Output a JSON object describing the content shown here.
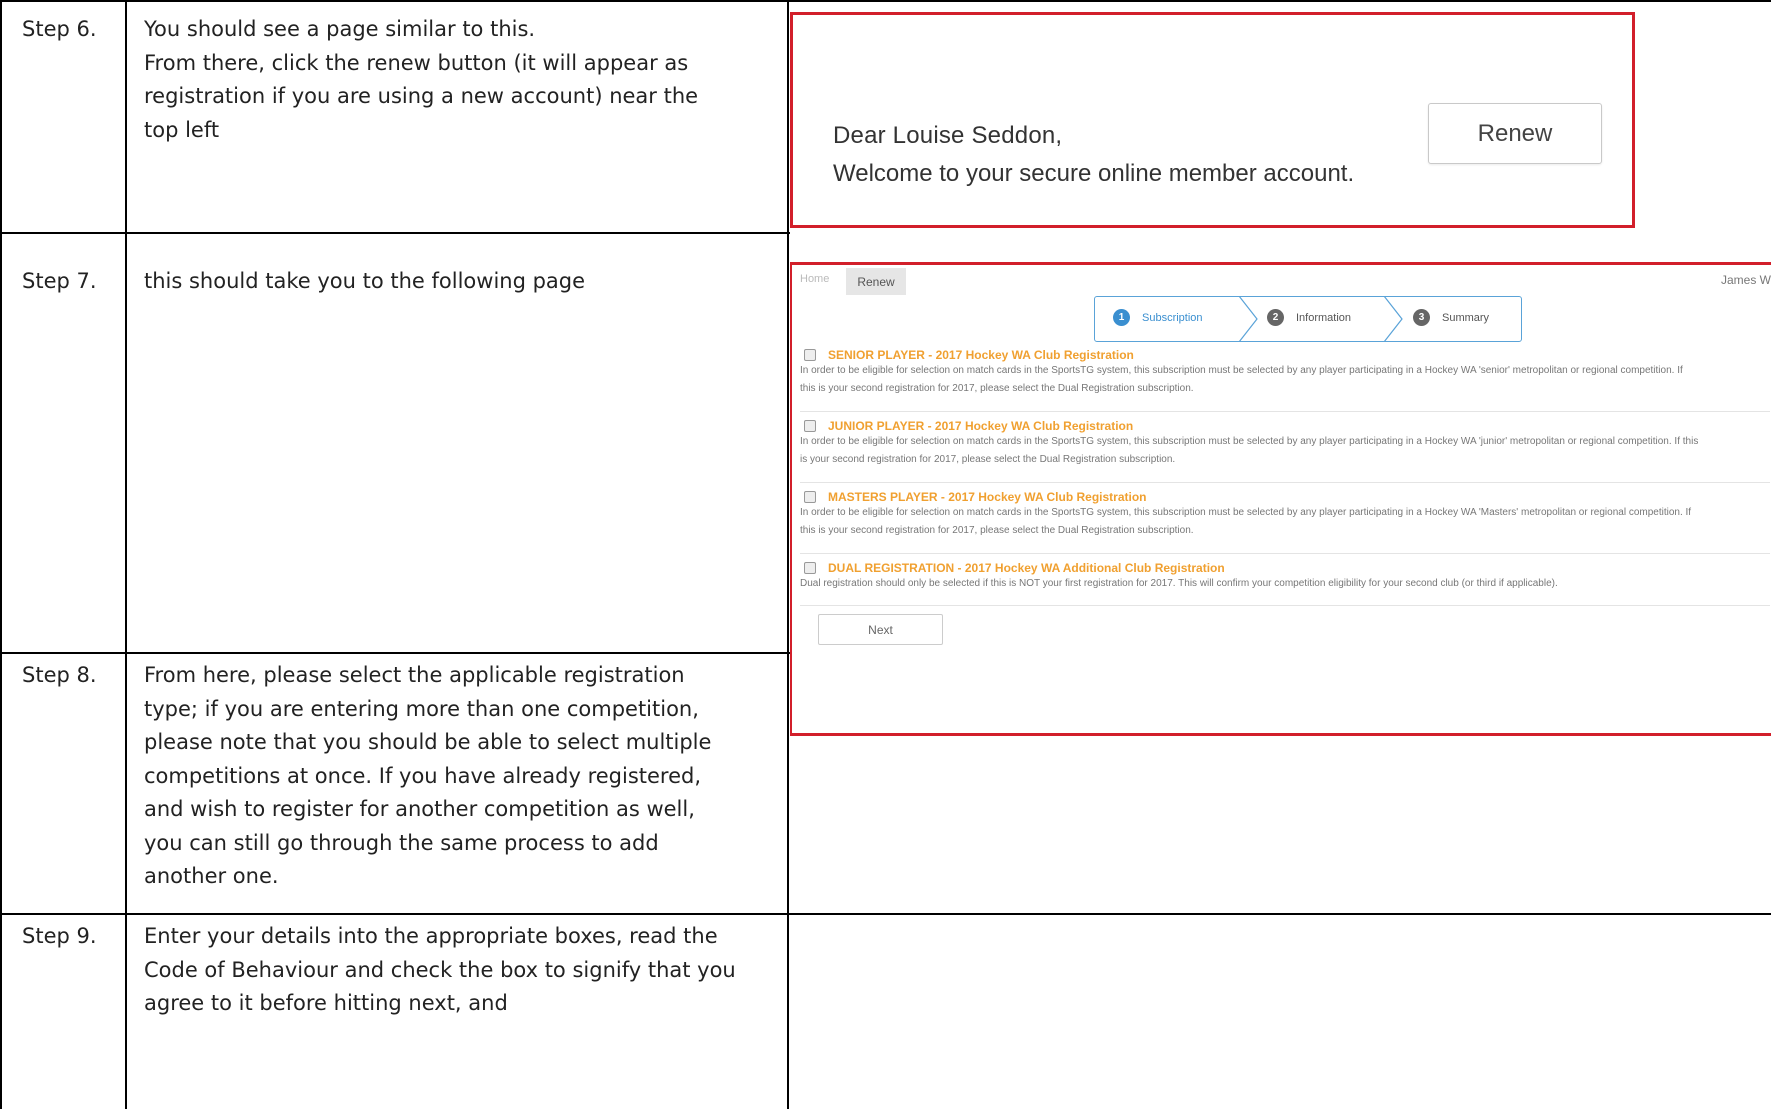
{
  "rows": [
    {
      "step": "Step 6.",
      "lines": [
        "You should see a page similar to this.",
        "From there, click the renew button (it will appear as",
        "registration if you are using a new account) near the",
        "top left"
      ]
    },
    {
      "step": "Step 7.",
      "lines": [
        "this should take you to the following page"
      ]
    },
    {
      "step": "Step 8.",
      "lines": [
        "From here, please select the applicable registration",
        "type; if you are entering more than one competition,",
        "please note that you should be able to select multiple",
        "competitions at once. If you have already registered,",
        "and wish to register for another competition as well,",
        "you can still go through the same process to add",
        "another one."
      ]
    },
    {
      "step": "Step 9.",
      "lines": [
        "Enter your details into the appropriate boxes, read the",
        "Code of Behaviour and check the box to signify that you",
        "agree to it before hitting next, and"
      ]
    }
  ],
  "account_screen": {
    "greeting": "Dear Louise Seddon,",
    "welcome": "Welcome to your secure online member account.",
    "renew_button": "Renew"
  },
  "registration_screen": {
    "nav_home": "Home",
    "nav_renew": "Renew",
    "user_name": "James W",
    "steps": [
      {
        "num": "1",
        "label": "Subscription",
        "active": true
      },
      {
        "num": "2",
        "label": "Information",
        "active": false
      },
      {
        "num": "3",
        "label": "Summary",
        "active": false
      }
    ],
    "subscriptions": [
      {
        "title": "SENIOR PLAYER - 2017 Hockey WA Club Registration",
        "desc1": "In order to be eligible for selection on match cards in the SportsTG system, this subscription must be selected by any player participating in a Hockey WA 'senior' metropolitan or regional competition. If",
        "desc2": "this is your second registration for 2017, please select the Dual Registration subscription."
      },
      {
        "title": "JUNIOR PLAYER - 2017 Hockey WA Club Registration",
        "desc1": "In order to be eligible for selection on match cards in the SportsTG system, this subscription must be selected by any player participating in a Hockey WA 'junior' metropolitan or regional competition. If this",
        "desc2": "is your second registration for 2017, please select the Dual Registration subscription."
      },
      {
        "title": "MASTERS PLAYER - 2017 Hockey WA Club Registration",
        "desc1": "In order to be eligible for selection on match cards in the SportsTG system, this subscription must be selected by any player participating in a Hockey WA 'Masters' metropolitan or regional competition. If",
        "desc2": "this is your second registration for 2017, please select the Dual Registration subscription."
      },
      {
        "title": "DUAL REGISTRATION - 2017 Hockey WA Additional Club Registration",
        "desc1": "Dual registration should only be selected if this is NOT your first registration for 2017. This will confirm your competition eligibility for your second club (or third if applicable).",
        "desc2": ""
      }
    ],
    "next_button": "Next"
  },
  "colors": {
    "highlight_border": "#d21f2a",
    "step_active": "#3a8fd0",
    "step_inactive": "#555555",
    "subscription_title": "#f0a030"
  }
}
